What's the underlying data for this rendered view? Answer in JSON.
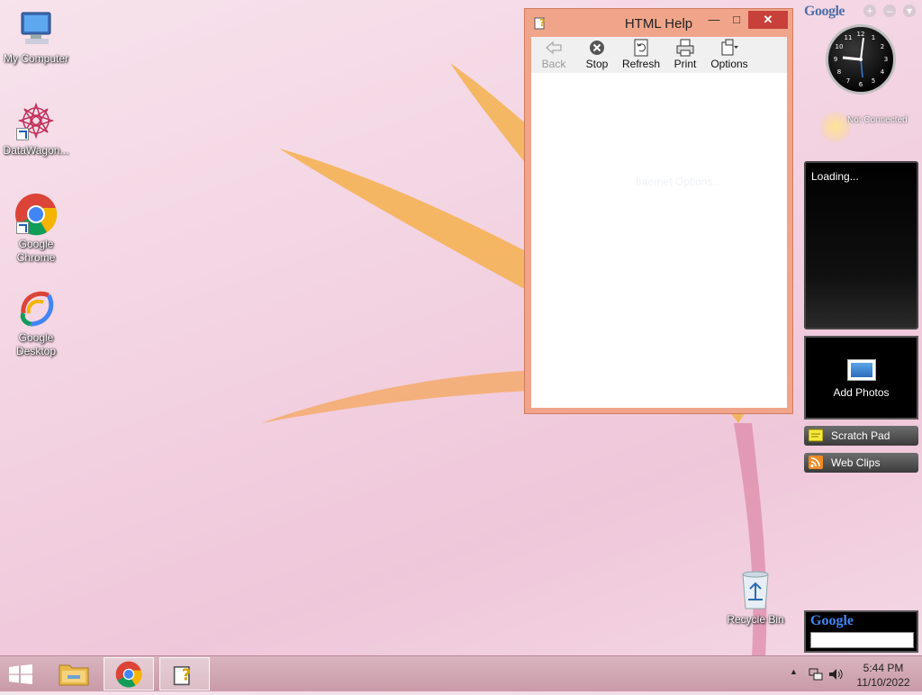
{
  "desktop": {
    "icons": [
      {
        "label": "My Computer"
      },
      {
        "label": "DataWagon..."
      },
      {
        "label": "Google Chrome"
      },
      {
        "label": "Google Desktop"
      }
    ],
    "recycle_bin": "Recycle Bin"
  },
  "help_window": {
    "title": "HTML Help",
    "toolbar": {
      "back": "Back",
      "stop": "Stop",
      "refresh": "Refresh",
      "print": "Print",
      "options": "Options"
    },
    "ghost_text": "Internet Options..."
  },
  "gadgets": {
    "logo": "Google",
    "status": "Not Connected",
    "loading": "Loading...",
    "add_photos": "Add Photos",
    "scratch_pad": "Scratch Pad",
    "web_clips": "Web Clips",
    "search_logo": "Google",
    "search_value": ""
  },
  "taskbar": {
    "time": "5:44 PM",
    "date": "11/10/2022"
  },
  "colors": {
    "title_bar": "#f0a58a",
    "close_button": "#c7403a",
    "taskbar": "#d9b4bf"
  }
}
